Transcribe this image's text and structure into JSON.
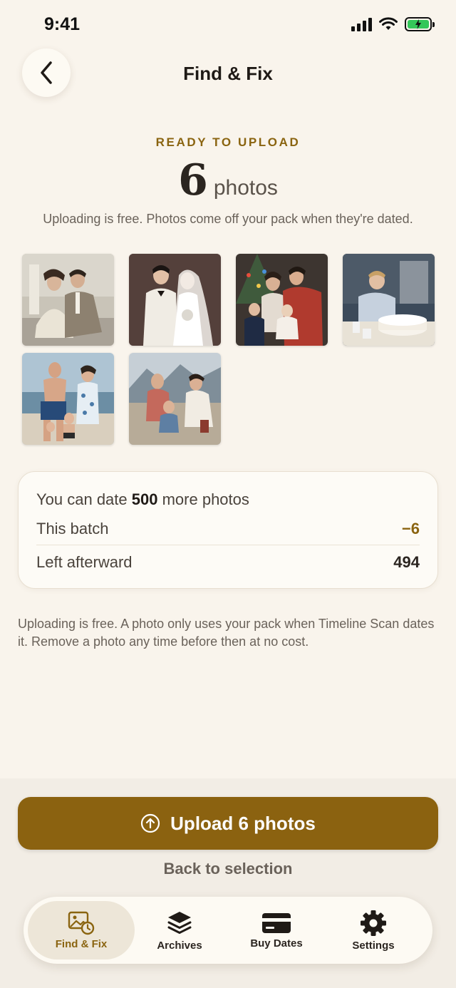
{
  "status": {
    "time": "9:41"
  },
  "header": {
    "title": "Find & Fix"
  },
  "summary": {
    "ready_label": "READY TO UPLOAD",
    "count": "6",
    "unit": "photos",
    "subtitle": "Uploading is free. Photos come off your pack when they're dated."
  },
  "photos": [
    {
      "label": "couple-on-steps"
    },
    {
      "label": "wedding-portrait"
    },
    {
      "label": "family-by-christmas-tree"
    },
    {
      "label": "boy-with-birthday-cake"
    },
    {
      "label": "family-at-beach"
    },
    {
      "label": "family-picnic-mountains"
    }
  ],
  "quota": {
    "headline_prefix": "You can date ",
    "headline_number": "500",
    "headline_suffix": " more photos",
    "batch_label": "This batch",
    "batch_value": "−6",
    "left_label": "Left afterward",
    "left_value": "494"
  },
  "note": "Uploading is free. A photo only uses your pack when Timeline Scan dates it. Remove a photo any time before then at no cost.",
  "actions": {
    "upload_label": "Upload 6 photos",
    "back_label": "Back to selection"
  },
  "tabs": [
    {
      "label": "Find & Fix",
      "icon": "photo-clock-icon",
      "active": true
    },
    {
      "label": "Archives",
      "icon": "layers-icon",
      "active": false
    },
    {
      "label": "Buy Dates",
      "icon": "credit-card-icon",
      "active": false
    },
    {
      "label": "Settings",
      "icon": "gear-icon",
      "active": false
    }
  ],
  "colors": {
    "accent": "#8b6210",
    "background": "#f9f4ec",
    "card": "#fdfbf6"
  }
}
